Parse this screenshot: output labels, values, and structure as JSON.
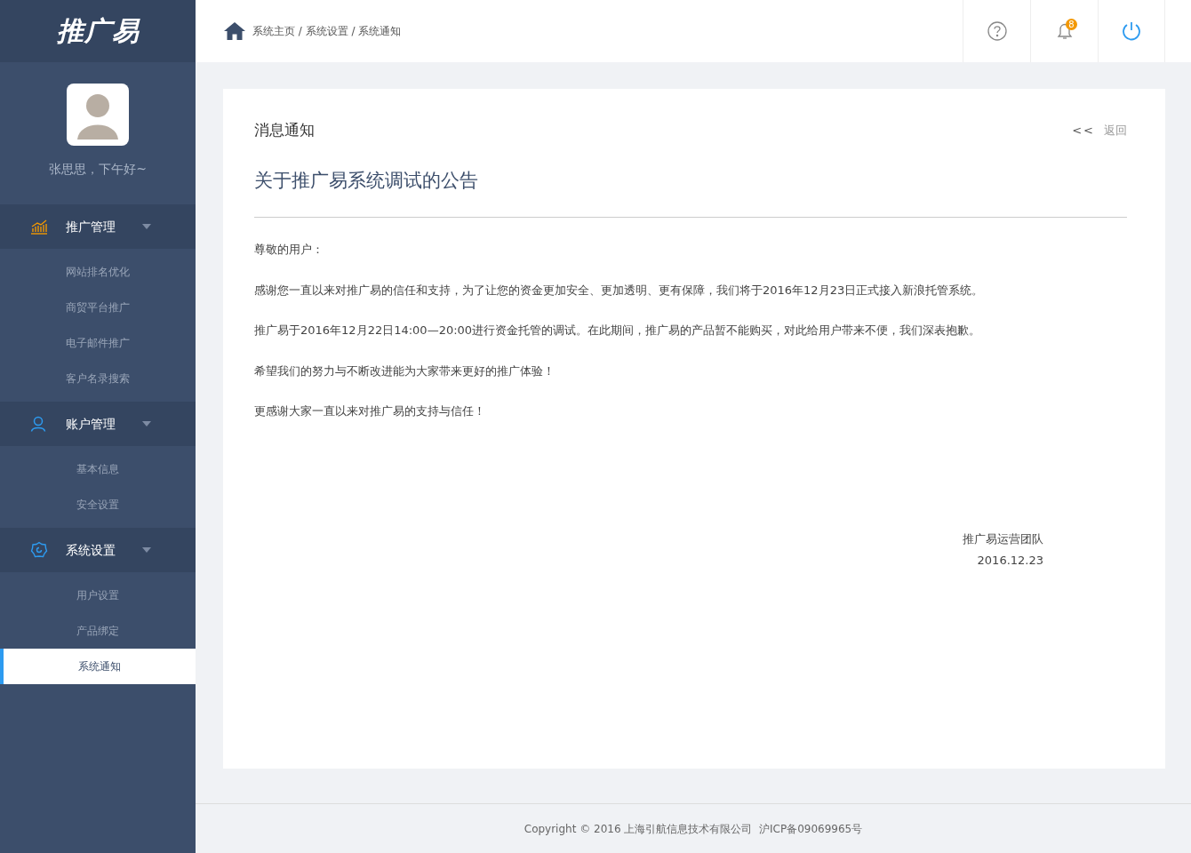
{
  "sidebar": {
    "logo": "推广易",
    "user": {
      "greeting": "张思思，下午好~"
    },
    "groups": [
      {
        "label": "推广管理",
        "kind": "chart",
        "expanded": true,
        "items": [
          {
            "label": "网站排名优化",
            "selected": false
          },
          {
            "label": "商贸平台推广",
            "selected": false
          },
          {
            "label": "电子邮件推广",
            "selected": false
          },
          {
            "label": "客户名录搜索",
            "selected": false
          }
        ]
      },
      {
        "label": "账户管理",
        "kind": "user",
        "expanded": true,
        "items": [
          {
            "label": "基本信息",
            "selected": false
          },
          {
            "label": "安全设置",
            "selected": false
          }
        ]
      },
      {
        "label": "系统设置",
        "kind": "gear",
        "expanded": true,
        "items": [
          {
            "label": "用户设置",
            "selected": false
          },
          {
            "label": "产品绑定",
            "selected": false
          },
          {
            "label": "系统通知",
            "selected": true
          }
        ]
      }
    ]
  },
  "header": {
    "breadcrumb": "系统主页 / 系统设置 / 系统通知",
    "notification_count": "8"
  },
  "panel": {
    "title": "消息通知",
    "back_arrow": "<<",
    "back_label": "返回",
    "article": {
      "title": "关于推广易系统调试的公告",
      "salutation": "尊敬的用户：",
      "paragraphs": [
        "感谢您一直以来对推广易的信任和支持，为了让您的资金更加安全、更加透明、更有保障，我们将于2016年12月23日正式接入新浪托管系统。",
        "推广易于2016年12月22日14:00—20:00进行资金托管的调试。在此期间，推广易的产品暂不能购买，对此给用户带来不便，我们深表抱歉。",
        "希望我们的努力与不断改进能为大家带来更好的推广体验！",
        "更感谢大家一直以来对推广易的支持与信任！"
      ],
      "signature": "推广易运营团队",
      "date": "2016.12.23"
    }
  },
  "footer": "Copyright © 2016 上海引航信息技术有限公司  沪ICP备09069965号"
}
